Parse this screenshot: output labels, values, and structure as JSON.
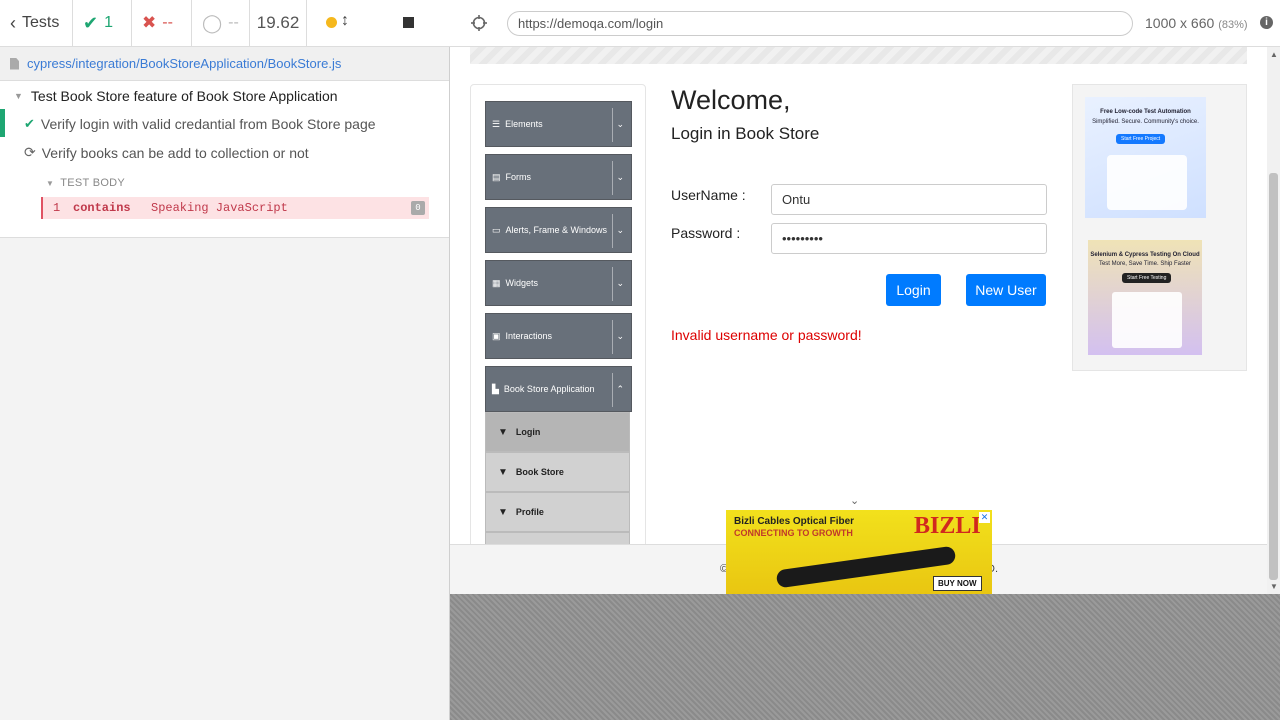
{
  "reporter": {
    "tests_label": "Tests",
    "passed_count": "1",
    "failed_count": "--",
    "pending_count": "--",
    "duration": "19.62",
    "spec_path": "cypress/integration/BookStoreApplication/BookStore.js",
    "suite_title": "Test Book Store feature of Book Store Application",
    "tests": [
      {
        "title": "Verify login with valid credantial from Book Store page",
        "state": "passed"
      },
      {
        "title": "Verify books can be add to collection or not",
        "state": "running"
      }
    ],
    "test_body_label": "TEST BODY",
    "command": {
      "number": "1",
      "name": "contains",
      "message": "Speaking JavaScript",
      "badge": "0"
    }
  },
  "runner": {
    "url": "https://demoqa.com/login",
    "viewport": "1000 x 660",
    "scale": "(83%)",
    "info_glyph": "i"
  },
  "app": {
    "menu": {
      "groups": [
        {
          "label": "Elements",
          "icon": "list-icon",
          "expanded": false
        },
        {
          "label": "Forms",
          "icon": "form-icon",
          "expanded": false
        },
        {
          "label": "Alerts, Frame & Windows",
          "icon": "window-icon",
          "expanded": false
        },
        {
          "label": "Widgets",
          "icon": "grid-icon",
          "expanded": false
        },
        {
          "label": "Interactions",
          "icon": "square-icon",
          "expanded": false
        },
        {
          "label": "Book Store Application",
          "icon": "book-icon",
          "expanded": true
        }
      ],
      "items": [
        {
          "label": "Login",
          "active": true
        },
        {
          "label": "Book Store",
          "active": false
        },
        {
          "label": "Profile",
          "active": false
        }
      ]
    },
    "login": {
      "title": "Welcome,",
      "subtitle": "Login in Book Store",
      "username_label": "UserName :",
      "username_value": "Ontu",
      "password_label": "Password :",
      "password_value": "•••••••••",
      "login_button": "Login",
      "new_user_button": "New User",
      "error": "Invalid username or password!"
    },
    "ads": {
      "ad1_title": "Free Low-code Test Automation",
      "ad1_sub": "Simplified. Secure. Community's choice.",
      "ad1_btn": "Start Free Project",
      "ad2_title": "Selenium & Cypress Testing On Cloud",
      "ad2_sub": "Test More, Save Time. Ship Faster",
      "ad2_btn": "Start Free Testing"
    },
    "footer": {
      "left": "©",
      "right": "D."
    },
    "banner": {
      "line1": "Bizli Cables Optical Fiber",
      "line2": "CONNECTING TO GROWTH",
      "logo": "BIZLI",
      "button": "BUY NOW",
      "close": "✕"
    },
    "colors": {
      "primary": "#007bff",
      "error": "#dd0000",
      "pass": "#1ea672",
      "fail": "#d9534f"
    }
  }
}
